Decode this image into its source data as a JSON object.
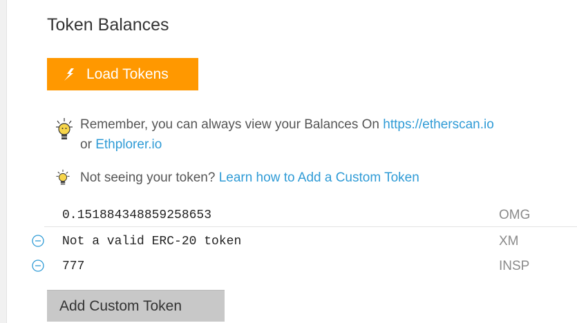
{
  "section": {
    "title": "Token Balances",
    "load_button_label": "Load Tokens"
  },
  "tips": {
    "view_balances": {
      "text": "Remember, you can always view your Balances On ",
      "link1": "https://etherscan.io",
      "connector": "or ",
      "link2": "Ethplorer.io"
    },
    "custom_token": {
      "text": "Not seeing your token? ",
      "link": "Learn how to Add a Custom Token"
    }
  },
  "tokens": [
    {
      "balance": "0.151884348859258653",
      "symbol": "OMG",
      "removable": false
    },
    {
      "balance": "Not a valid ERC-20 token",
      "symbol": "XM",
      "removable": true
    },
    {
      "balance": "777",
      "symbol": "INSP",
      "removable": true
    }
  ],
  "add_button_label": "Add Custom Token",
  "colors": {
    "accent": "#ff9800",
    "link": "#2f9bd6",
    "remove_icon": "#2f9bd6"
  },
  "icons": {
    "load": "download-arrow-icon",
    "tip": "lightbulb-icon",
    "remove": "minus-circle-icon"
  }
}
